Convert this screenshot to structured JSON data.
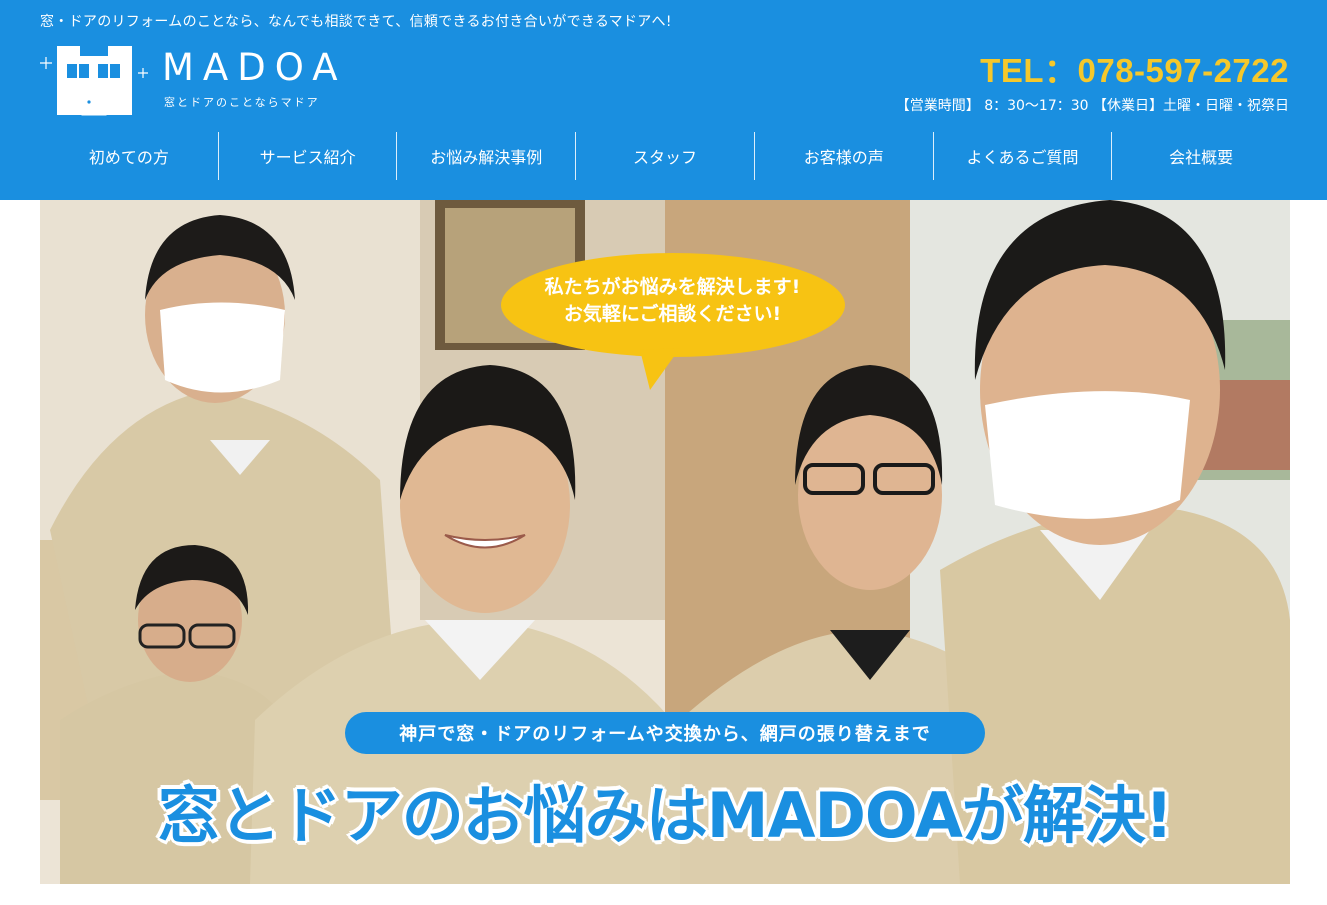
{
  "header": {
    "tagline": "窓・ドアのリフォームのことなら、なんでも相談できて、信頼できるお付き合いができるマドアへ!",
    "logo": {
      "name": "MADOA",
      "subtitle": "窓とドアのことならマドア"
    },
    "tel": "TEL：078-597-2722",
    "hours": "【営業時間】 8：30〜17：30 【休業日】土曜・日曜・祝祭日"
  },
  "nav": {
    "items": [
      {
        "label": "初めての方"
      },
      {
        "label": "サービス紹介"
      },
      {
        "label": "お悩み解決事例"
      },
      {
        "label": "スタッフ"
      },
      {
        "label": "お客様の声"
      },
      {
        "label": "よくあるご質問"
      },
      {
        "label": "会社概要"
      }
    ]
  },
  "hero": {
    "bubble_line1": "私たちがお悩みを解決します!",
    "bubble_line2": "お気軽にご相談ください!",
    "ribbon": "神戸で窓・ドアのリフォームや交換から、網戸の張り替えまで",
    "headline": "窓とドアのお悩みはMADOAが解決!"
  },
  "colors": {
    "brand_blue": "#1a8fe0",
    "tel_yellow": "#f5c82b",
    "bubble_yellow": "#f7c313"
  }
}
